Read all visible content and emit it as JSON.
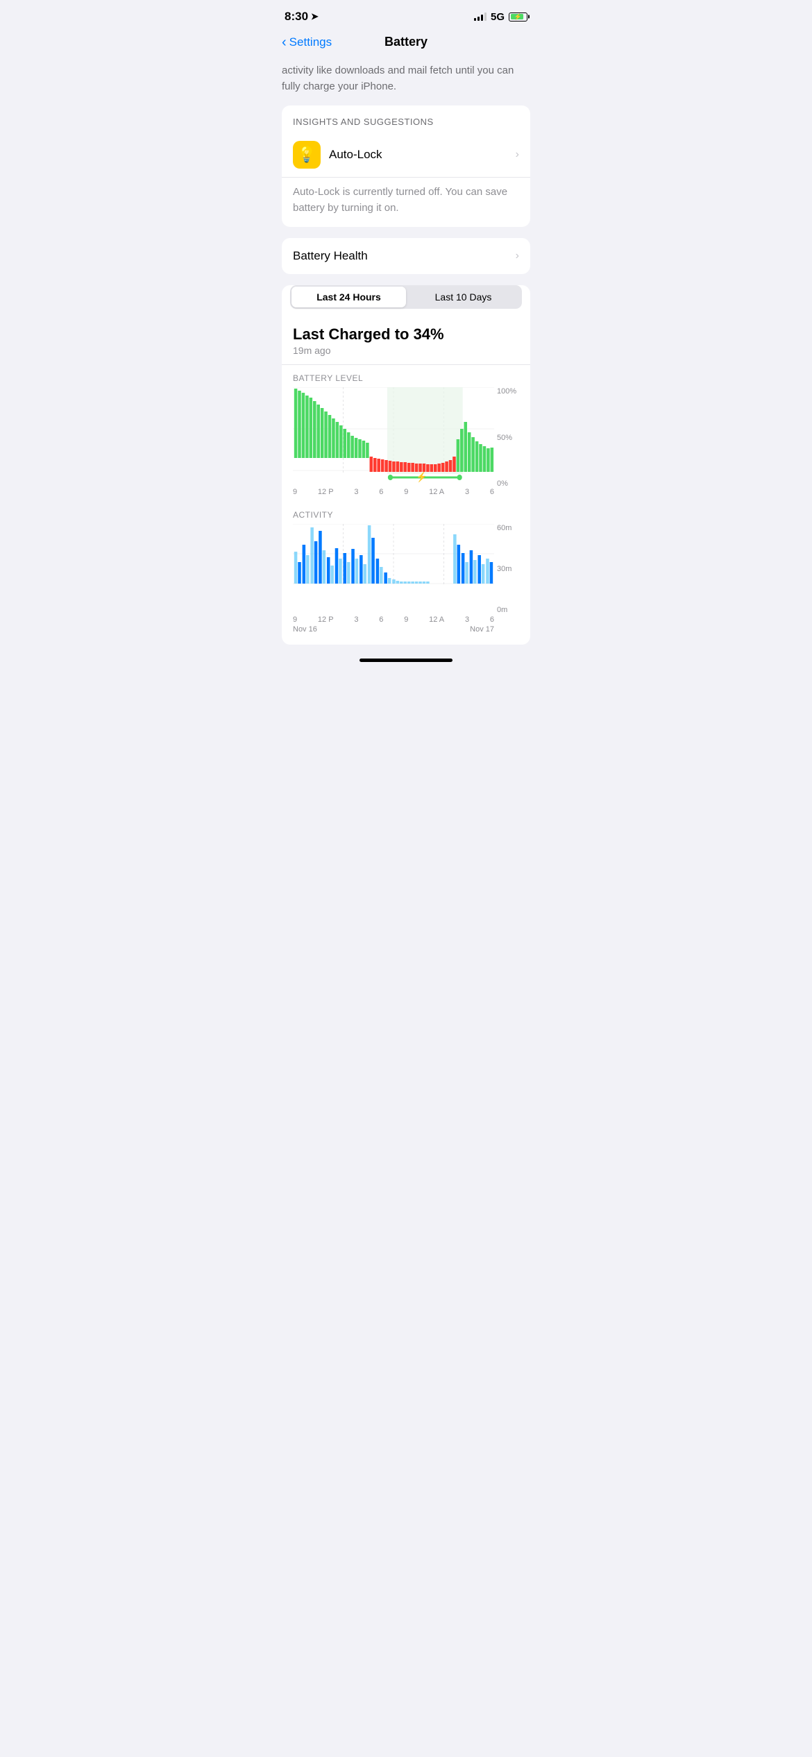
{
  "status": {
    "time": "8:30",
    "network": "5G"
  },
  "nav": {
    "back_label": "Settings",
    "title": "Battery"
  },
  "intro_text": "activity like downloads and mail fetch until you can fully charge your iPhone.",
  "insights": {
    "section_header": "INSIGHTS AND SUGGESTIONS",
    "item_title": "Auto-Lock",
    "item_description": "Auto-Lock is currently turned off. You can save battery by turning it on."
  },
  "battery_health": {
    "label": "Battery Health"
  },
  "chart": {
    "segment_left": "Last 24 Hours",
    "segment_right": "Last 10 Days",
    "charge_title": "Last Charged to 34%",
    "charge_subtitle": "19m ago",
    "battery_level_label": "BATTERY LEVEL",
    "activity_label": "ACTIVITY",
    "y_labels_battery": [
      "100%",
      "50%",
      "0%"
    ],
    "y_labels_activity": [
      "60m",
      "30m",
      "0m"
    ],
    "x_labels": [
      "9",
      "12 P",
      "3",
      "6",
      "9",
      "12 A",
      "3",
      "6"
    ],
    "date_labels_left": "Nov 16",
    "date_labels_right": "Nov 17"
  }
}
